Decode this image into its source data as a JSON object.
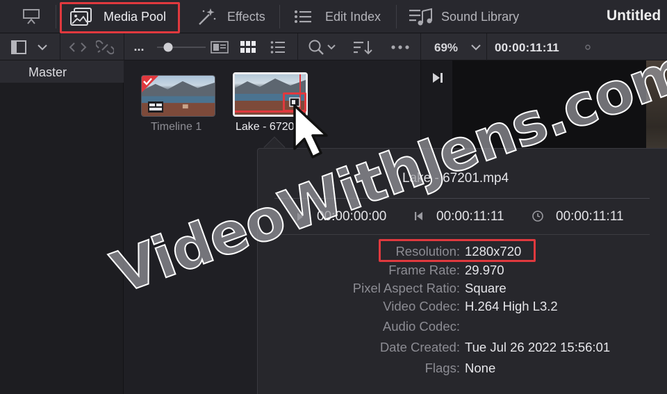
{
  "topbar": {
    "media_pool_label": "Media Pool",
    "effects_label": "Effects",
    "edit_index_label": "Edit Index",
    "sound_library_label": "Sound Library",
    "project_title": "Untitled"
  },
  "toolbar": {
    "more_label": "...",
    "zoom_value": "69%",
    "timecode": "00:00:11:11"
  },
  "bin": {
    "master_label": "Master"
  },
  "clips": [
    {
      "name": "Timeline 1"
    },
    {
      "name": "Lake - 6720"
    }
  ],
  "popup": {
    "title": "Lake - 67201.mp4",
    "start_tc": "00:00:00:00",
    "end_tc": "00:00:11:11",
    "duration_tc": "00:00:11:11",
    "properties": [
      {
        "label": "Resolution:",
        "value": "1280x720"
      },
      {
        "label": "Frame Rate:",
        "value": "29.970"
      },
      {
        "label": "Pixel Aspect Ratio:",
        "value": "Square"
      },
      {
        "label": "Video Codec:",
        "value": "H.264 High L3.2"
      },
      {
        "label": "Audio Codec:",
        "value": ""
      },
      {
        "label": "Date Created:",
        "value": "Tue Jul 26 2022 15:56:01"
      },
      {
        "label": "Flags:",
        "value": "None"
      }
    ]
  },
  "watermark": "VideoWithJens.com",
  "colors": {
    "highlight_red": "#e0393e",
    "panel_bg": "#1f1f24",
    "popup_bg": "#27272c"
  }
}
